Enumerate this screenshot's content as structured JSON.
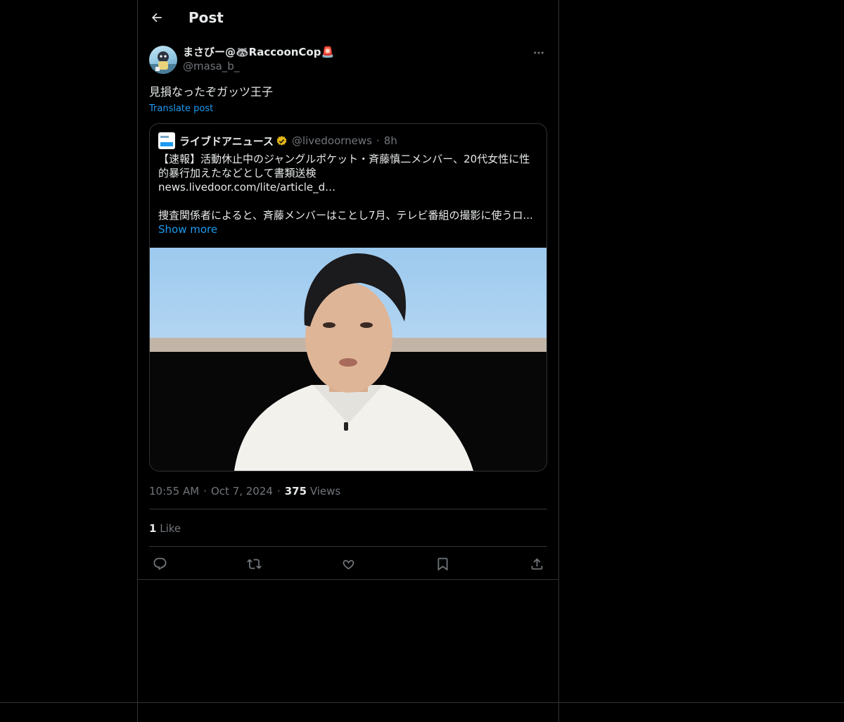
{
  "header": {
    "title": "Post",
    "back_icon": "arrow-left-icon"
  },
  "post": {
    "display_name": "まさびー@🦝RaccoonCop🚨",
    "handle": "@masa_b_",
    "text": "見損なったぞガッツ王子",
    "translate_label": "Translate post",
    "more_icon": "more-horizontal-icon"
  },
  "quote": {
    "name": "ライブドアニュース",
    "handle": "@livedoornews",
    "separator": "·",
    "time": "8h",
    "line1": "【速報】活動休止中のジャングルポケット・斉藤慎二メンバー、20代女性に性",
    "line2": "的暴行加えたなどとして書類送検",
    "line3": "news.livedoor.com/lite/article_d…",
    "line4": "捜査関係者によると、斉藤メンバーはことし7月、テレビ番組の撮影に使うロ...",
    "show_more": "Show more",
    "verified_color": "#e2b719"
  },
  "meta": {
    "time": "10:55 AM",
    "sep1": "·",
    "date": "Oct 7, 2024",
    "sep2": "·",
    "views_count": "375",
    "views_label": "Views"
  },
  "likes": {
    "count": "1",
    "label": "Like"
  },
  "actions": {
    "reply_icon": "reply-icon",
    "repost_icon": "repost-icon",
    "like_icon": "heart-icon",
    "bookmark_icon": "bookmark-icon",
    "share_icon": "share-icon"
  },
  "colors": {
    "background": "#000000",
    "text": "#e7e9ea",
    "secondary": "#71767b",
    "link": "#1d9bf0",
    "border": "#2f3336"
  }
}
